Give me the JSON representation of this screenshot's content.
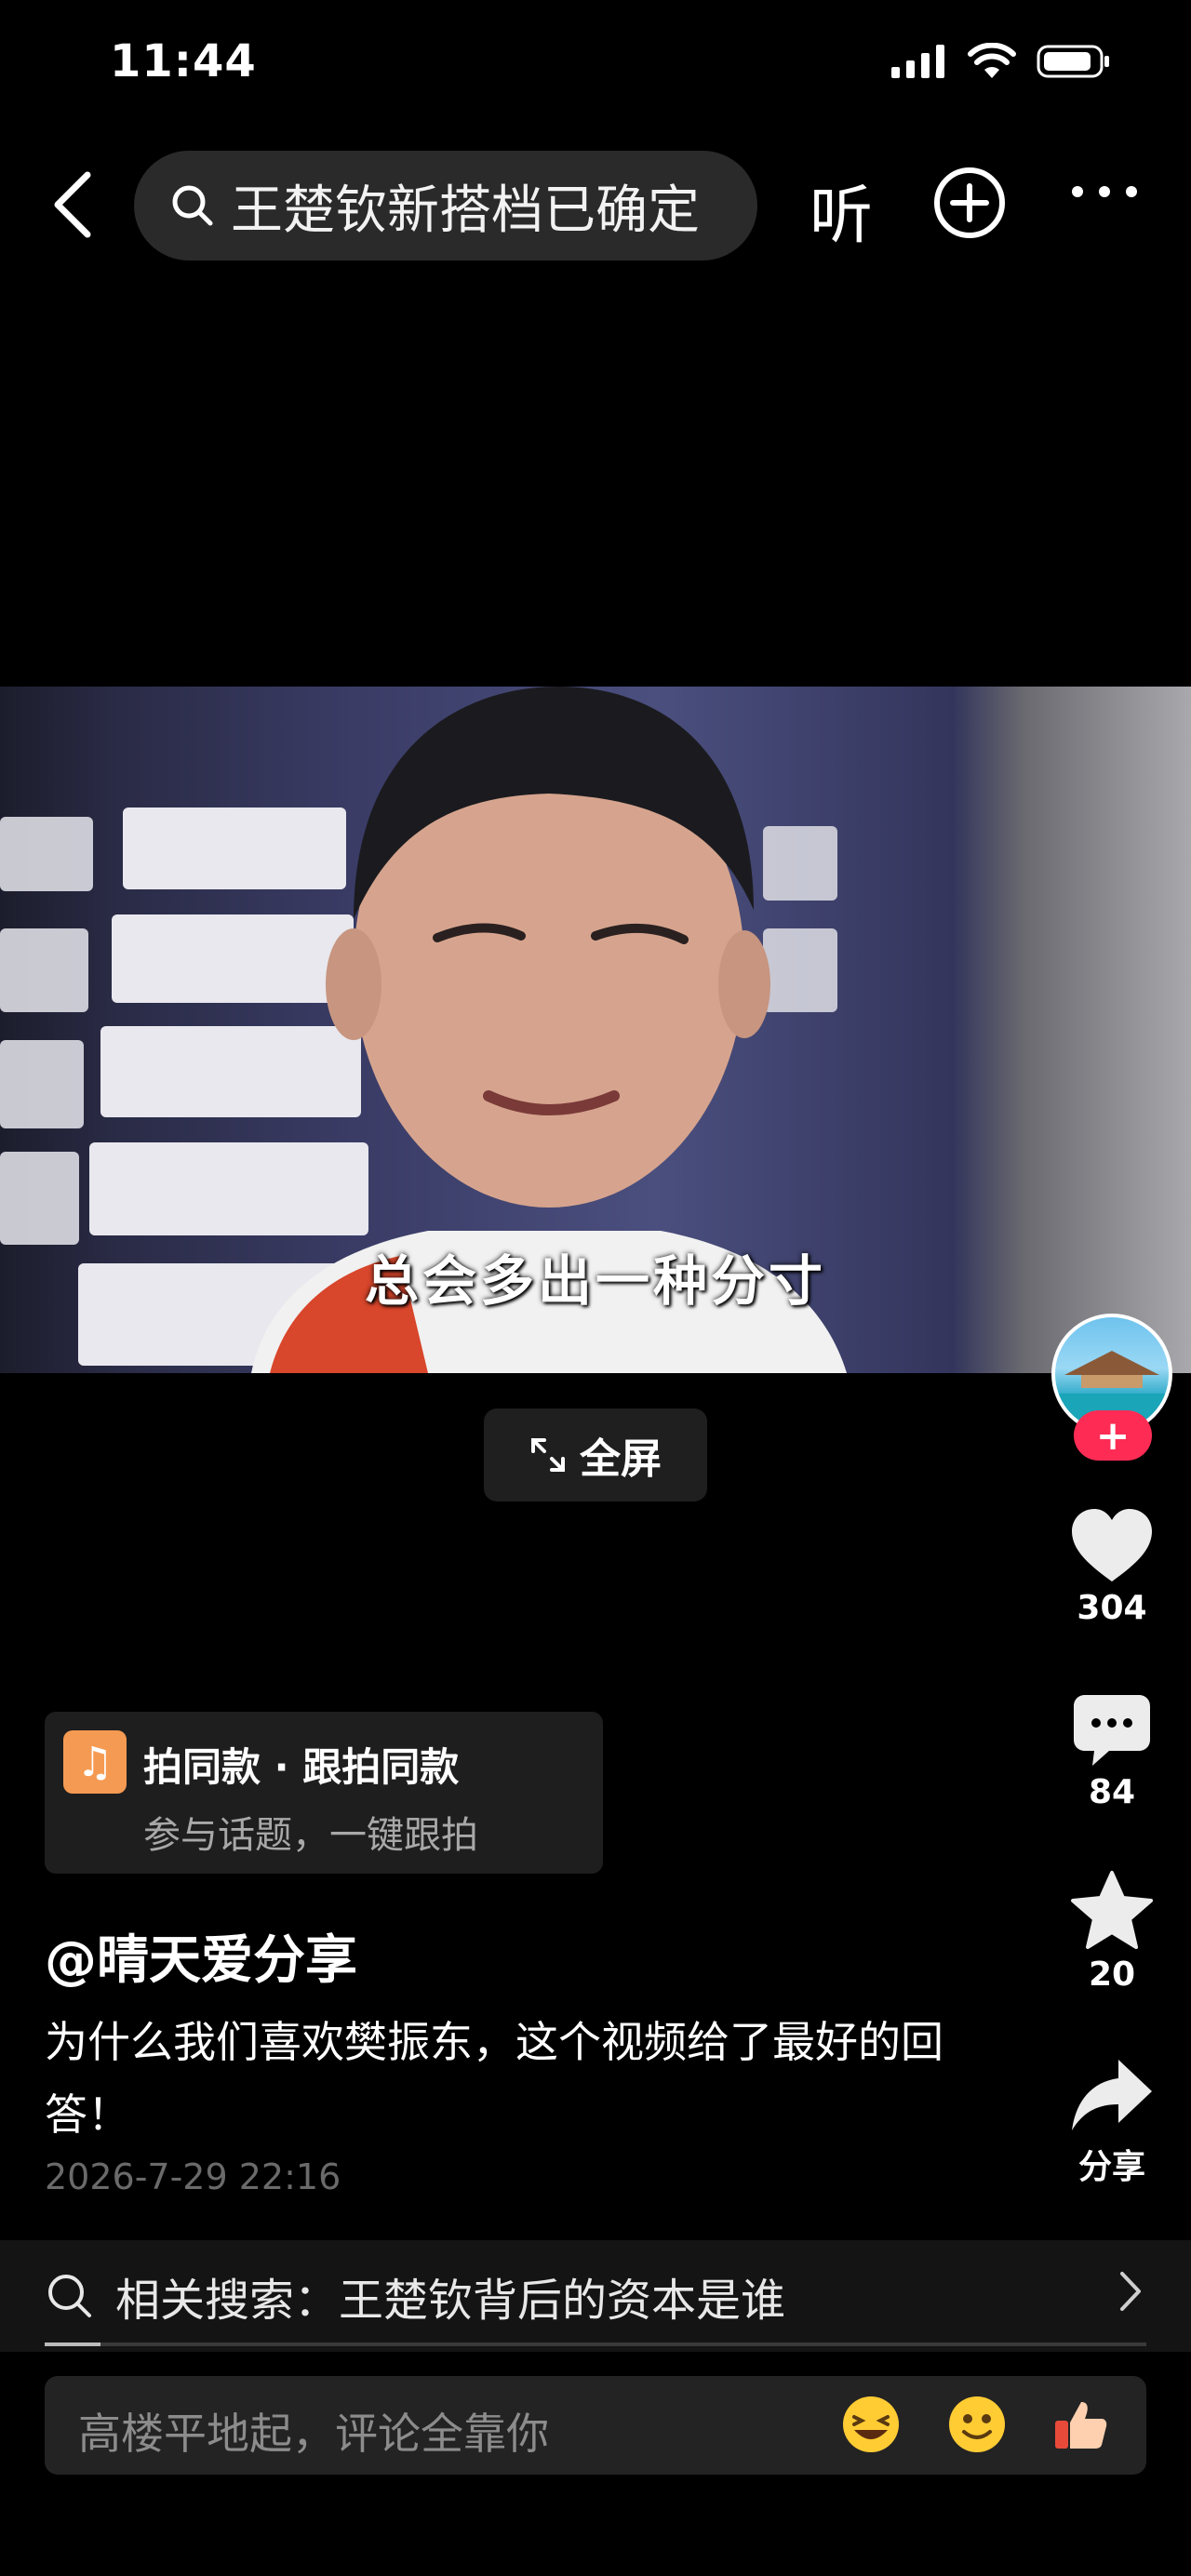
{
  "status_bar": {
    "time": "11:44"
  },
  "top_bar": {
    "search_query": "王楚钦新搭档已确定",
    "listen_label": "听"
  },
  "video": {
    "subtitle": "总会多出一种分寸",
    "fullscreen_label": "全屏"
  },
  "rail": {
    "like_count": "304",
    "comment_count": "84",
    "favorite_count": "20",
    "share_label": "分享"
  },
  "template": {
    "title": "拍同款 · 跟拍同款",
    "subtitle": "参与话题，一键跟拍"
  },
  "post": {
    "author": "@晴天爱分享",
    "description": "为什么我们喜欢樊振东，这个视频给了最好的回答！",
    "date": "2026-7-29 22:16"
  },
  "related_search": {
    "text": "相关搜索：王楚钦背后的资本是谁"
  },
  "comment_bar": {
    "placeholder": "高楼平地起，评论全靠你"
  },
  "colors": {
    "accent_red": "#fe2c55",
    "music_orange": "#f59a52",
    "background": "#000000"
  },
  "icons": [
    "back-icon",
    "search-icon",
    "plus-circle-icon",
    "more-icon",
    "expand-icon",
    "heart-icon",
    "comment-icon",
    "star-icon",
    "share-icon",
    "music-icon",
    "chevron-right-icon",
    "laugh-emoji-icon",
    "smile-emoji-icon",
    "thumbs-up-emoji-icon"
  ]
}
